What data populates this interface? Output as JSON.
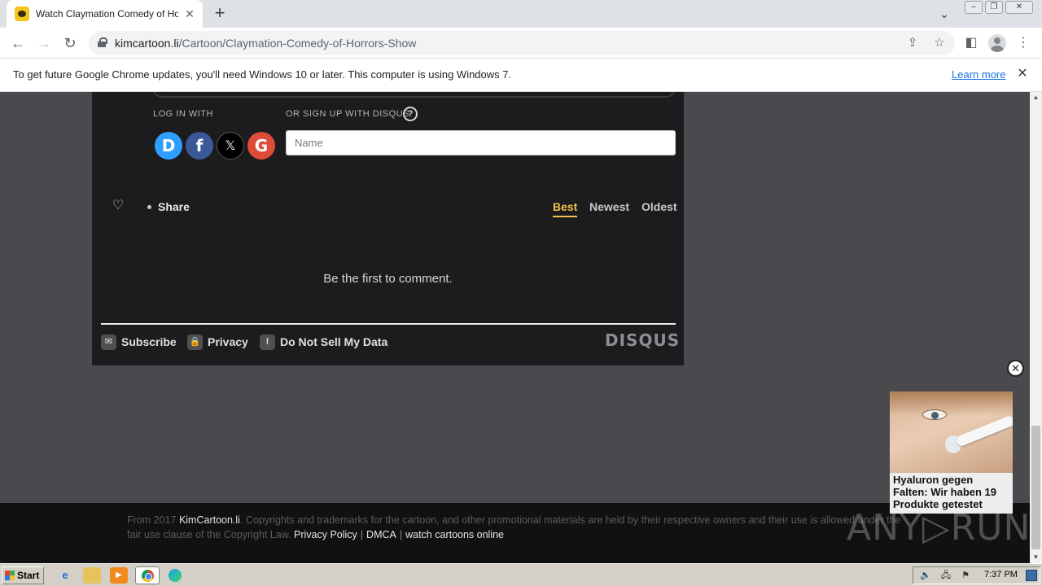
{
  "browser": {
    "tab_title": "Watch Claymation Comedy of Horrors",
    "tab_close": "✕",
    "new_tab": "+",
    "url_domain": "kimcartoon.li",
    "url_path": "/Cartoon/Claymation-Comedy-of-Horrors-Show",
    "window_controls": [
      "–",
      "❐",
      "✕"
    ]
  },
  "infobar": {
    "message": "To get future Google Chrome updates, you'll need Windows 10 or later. This computer is using Windows 7.",
    "learn_more": "Learn more",
    "close": "✕"
  },
  "disqus": {
    "log_in_with": "LOG IN WITH",
    "or_sign_up": "OR SIGN UP WITH DISQUS",
    "help": "?",
    "social": {
      "disqus": "D",
      "facebook": "f",
      "x": "𝕏",
      "google": "G"
    },
    "name_placeholder": "Name",
    "heart": "♡",
    "share": "Share",
    "sort": {
      "best": "Best",
      "newest": "Newest",
      "oldest": "Oldest"
    },
    "empty_message": "Be the first to comment.",
    "footer": {
      "subscribe": "Subscribe",
      "privacy": "Privacy",
      "do_not_sell": "Do Not Sell My Data"
    },
    "logo": "DISQUS"
  },
  "ad": {
    "close": "✕",
    "caption": "Hyaluron gegen Falten: Wir haben 19 Produkte getestet"
  },
  "site_footer": {
    "prefix": "From 2017",
    "site_link": "KimCartoon.li",
    "body": ". Copyrights and trademarks for the cartoon, and other promotional materials are held by their respective owners and their use is allowed under the fair use clause of the Copyright Law.",
    "privacy_policy": "Privacy Policy",
    "dmca": "DMCA",
    "watch_online": "watch cartoons online",
    "separator": "|"
  },
  "watermark": "ANY▷RUN",
  "taskbar": {
    "start": "Start",
    "clock": "7:37 PM"
  },
  "colors": {
    "accent_sort": "#f1c04c",
    "disqus_bg": "#1c1c1e",
    "page_bg": "#4a4a4e",
    "link_blue": "#1a73e8"
  }
}
